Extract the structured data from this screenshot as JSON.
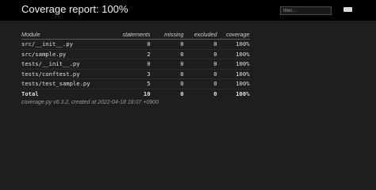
{
  "header": {
    "title": "Coverage report: 100%",
    "filter_placeholder": "filter...",
    "icon": "keyboard-icon"
  },
  "table": {
    "columns": [
      "Module",
      "statements",
      "missing",
      "excluded",
      "coverage"
    ],
    "rows": [
      {
        "module": "src/__init__.py",
        "statements": "0",
        "missing": "0",
        "excluded": "0",
        "coverage": "100%"
      },
      {
        "module": "src/sample.py",
        "statements": "2",
        "missing": "0",
        "excluded": "0",
        "coverage": "100%"
      },
      {
        "module": "tests/__init__.py",
        "statements": "0",
        "missing": "0",
        "excluded": "0",
        "coverage": "100%"
      },
      {
        "module": "tests/conftest.py",
        "statements": "3",
        "missing": "0",
        "excluded": "0",
        "coverage": "100%"
      },
      {
        "module": "tests/test_sample.py",
        "statements": "5",
        "missing": "0",
        "excluded": "0",
        "coverage": "100%"
      }
    ],
    "total": {
      "module": "Total",
      "statements": "10",
      "missing": "0",
      "excluded": "0",
      "coverage": "100%"
    }
  },
  "footer": {
    "text": "coverage.py v6.3.2, created at 2022-04-18 18:07 +0900"
  }
}
